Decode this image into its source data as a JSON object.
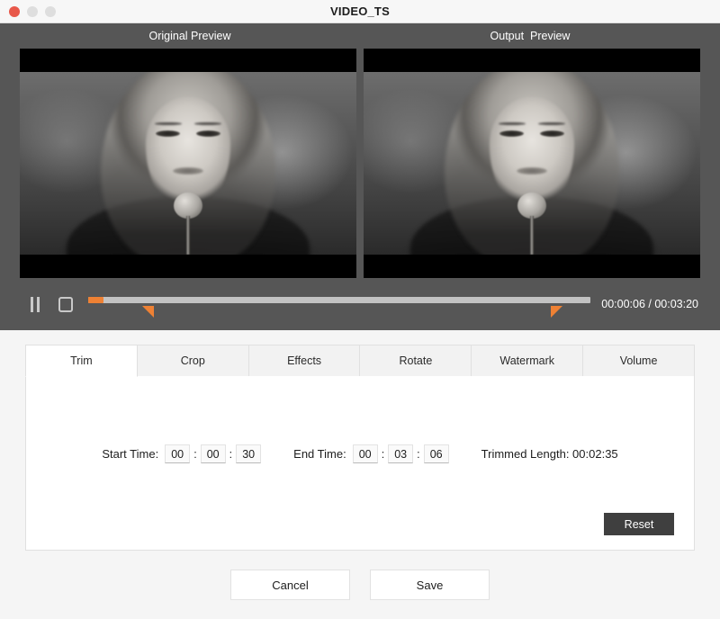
{
  "window": {
    "title": "VIDEO_TS",
    "traffic_lights": {
      "close": "close-button",
      "minimize": "minimize-button",
      "maximize": "maximize-button"
    }
  },
  "preview": {
    "original_label": "Original Preview",
    "output_label": "Output  Preview"
  },
  "transport": {
    "pause_icon": "pause-icon",
    "stop_icon": "stop-icon",
    "current_time": "00:00:06",
    "total_time": "00:03:20",
    "timecode": "00:00:06 / 00:03:20",
    "played_percent": 3,
    "trim_start_percent": 13,
    "trim_end_percent": 92,
    "accent_color": "#ee8134",
    "track_color": "#c2c2c2"
  },
  "tabs": [
    {
      "label": "Trim",
      "active": true
    },
    {
      "label": "Crop",
      "active": false
    },
    {
      "label": "Effects",
      "active": false
    },
    {
      "label": "Rotate",
      "active": false
    },
    {
      "label": "Watermark",
      "active": false
    },
    {
      "label": "Volume",
      "active": false
    }
  ],
  "trim_panel": {
    "start_label": "Start Time:",
    "start_hours": "00",
    "start_minutes": "00",
    "start_seconds": "30",
    "end_label": "End Time:",
    "end_hours": "00",
    "end_minutes": "03",
    "end_seconds": "06",
    "trimmed_length_label": "Trimmed Length:",
    "trimmed_length_value": "00:02:35",
    "trimmed_length_full": "Trimmed Length: 00:02:35",
    "separator": ":",
    "reset_label": "Reset"
  },
  "footer": {
    "cancel_label": "Cancel",
    "save_label": "Save"
  }
}
